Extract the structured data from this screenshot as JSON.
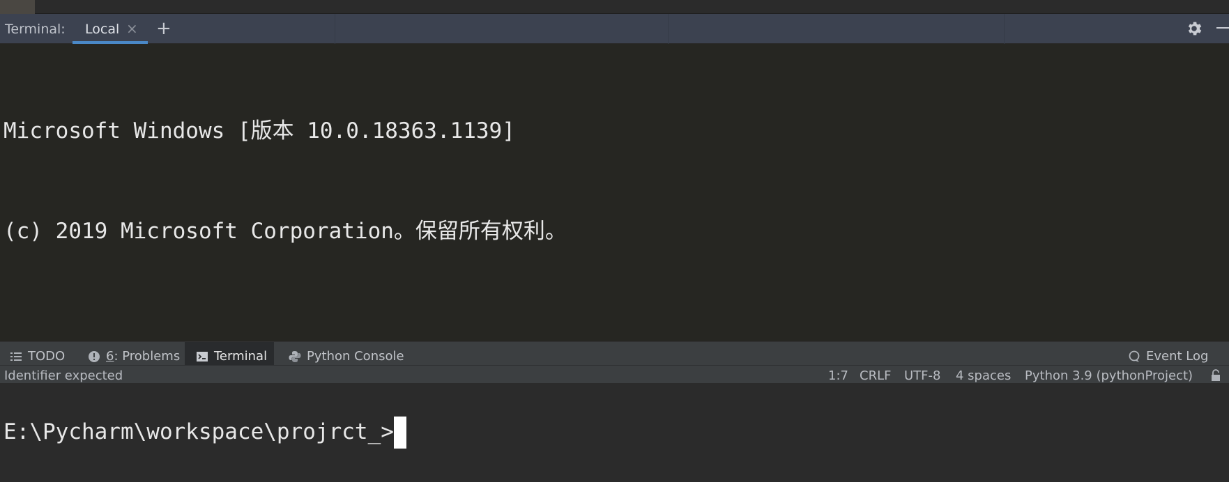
{
  "tool_window": {
    "title": "Terminal:",
    "tabs": [
      {
        "label": "Local",
        "close": "×"
      }
    ],
    "add_tab": "+"
  },
  "terminal": {
    "lines": [
      "Microsoft Windows [版本 10.0.18363.1139]",
      "(c) 2019 Microsoft Corporation。保留所有权利。",
      "",
      "E:\\Pycharm\\workspace\\projrct_>"
    ]
  },
  "bottom_tools": {
    "todo": "TODO",
    "problems_num": "6",
    "problems_rest": ": Problems",
    "terminal": "Terminal",
    "python_console": "Python Console",
    "event_log": "Event Log"
  },
  "status": {
    "message": "Identifier expected",
    "position": "1:7",
    "line_sep": "CRLF",
    "encoding": "UTF-8",
    "indent": "4 spaces",
    "interpreter": "Python 3.9 (pythonProject)"
  },
  "colors": {
    "header_bg": "#3c4250",
    "terminal_bg": "#262622",
    "accent": "#4a88c7"
  },
  "icons": [
    "gear-icon",
    "minimize-icon",
    "list-icon",
    "problems-icon",
    "terminal-icon",
    "python-icon",
    "event-log-icon",
    "lock-icon"
  ]
}
